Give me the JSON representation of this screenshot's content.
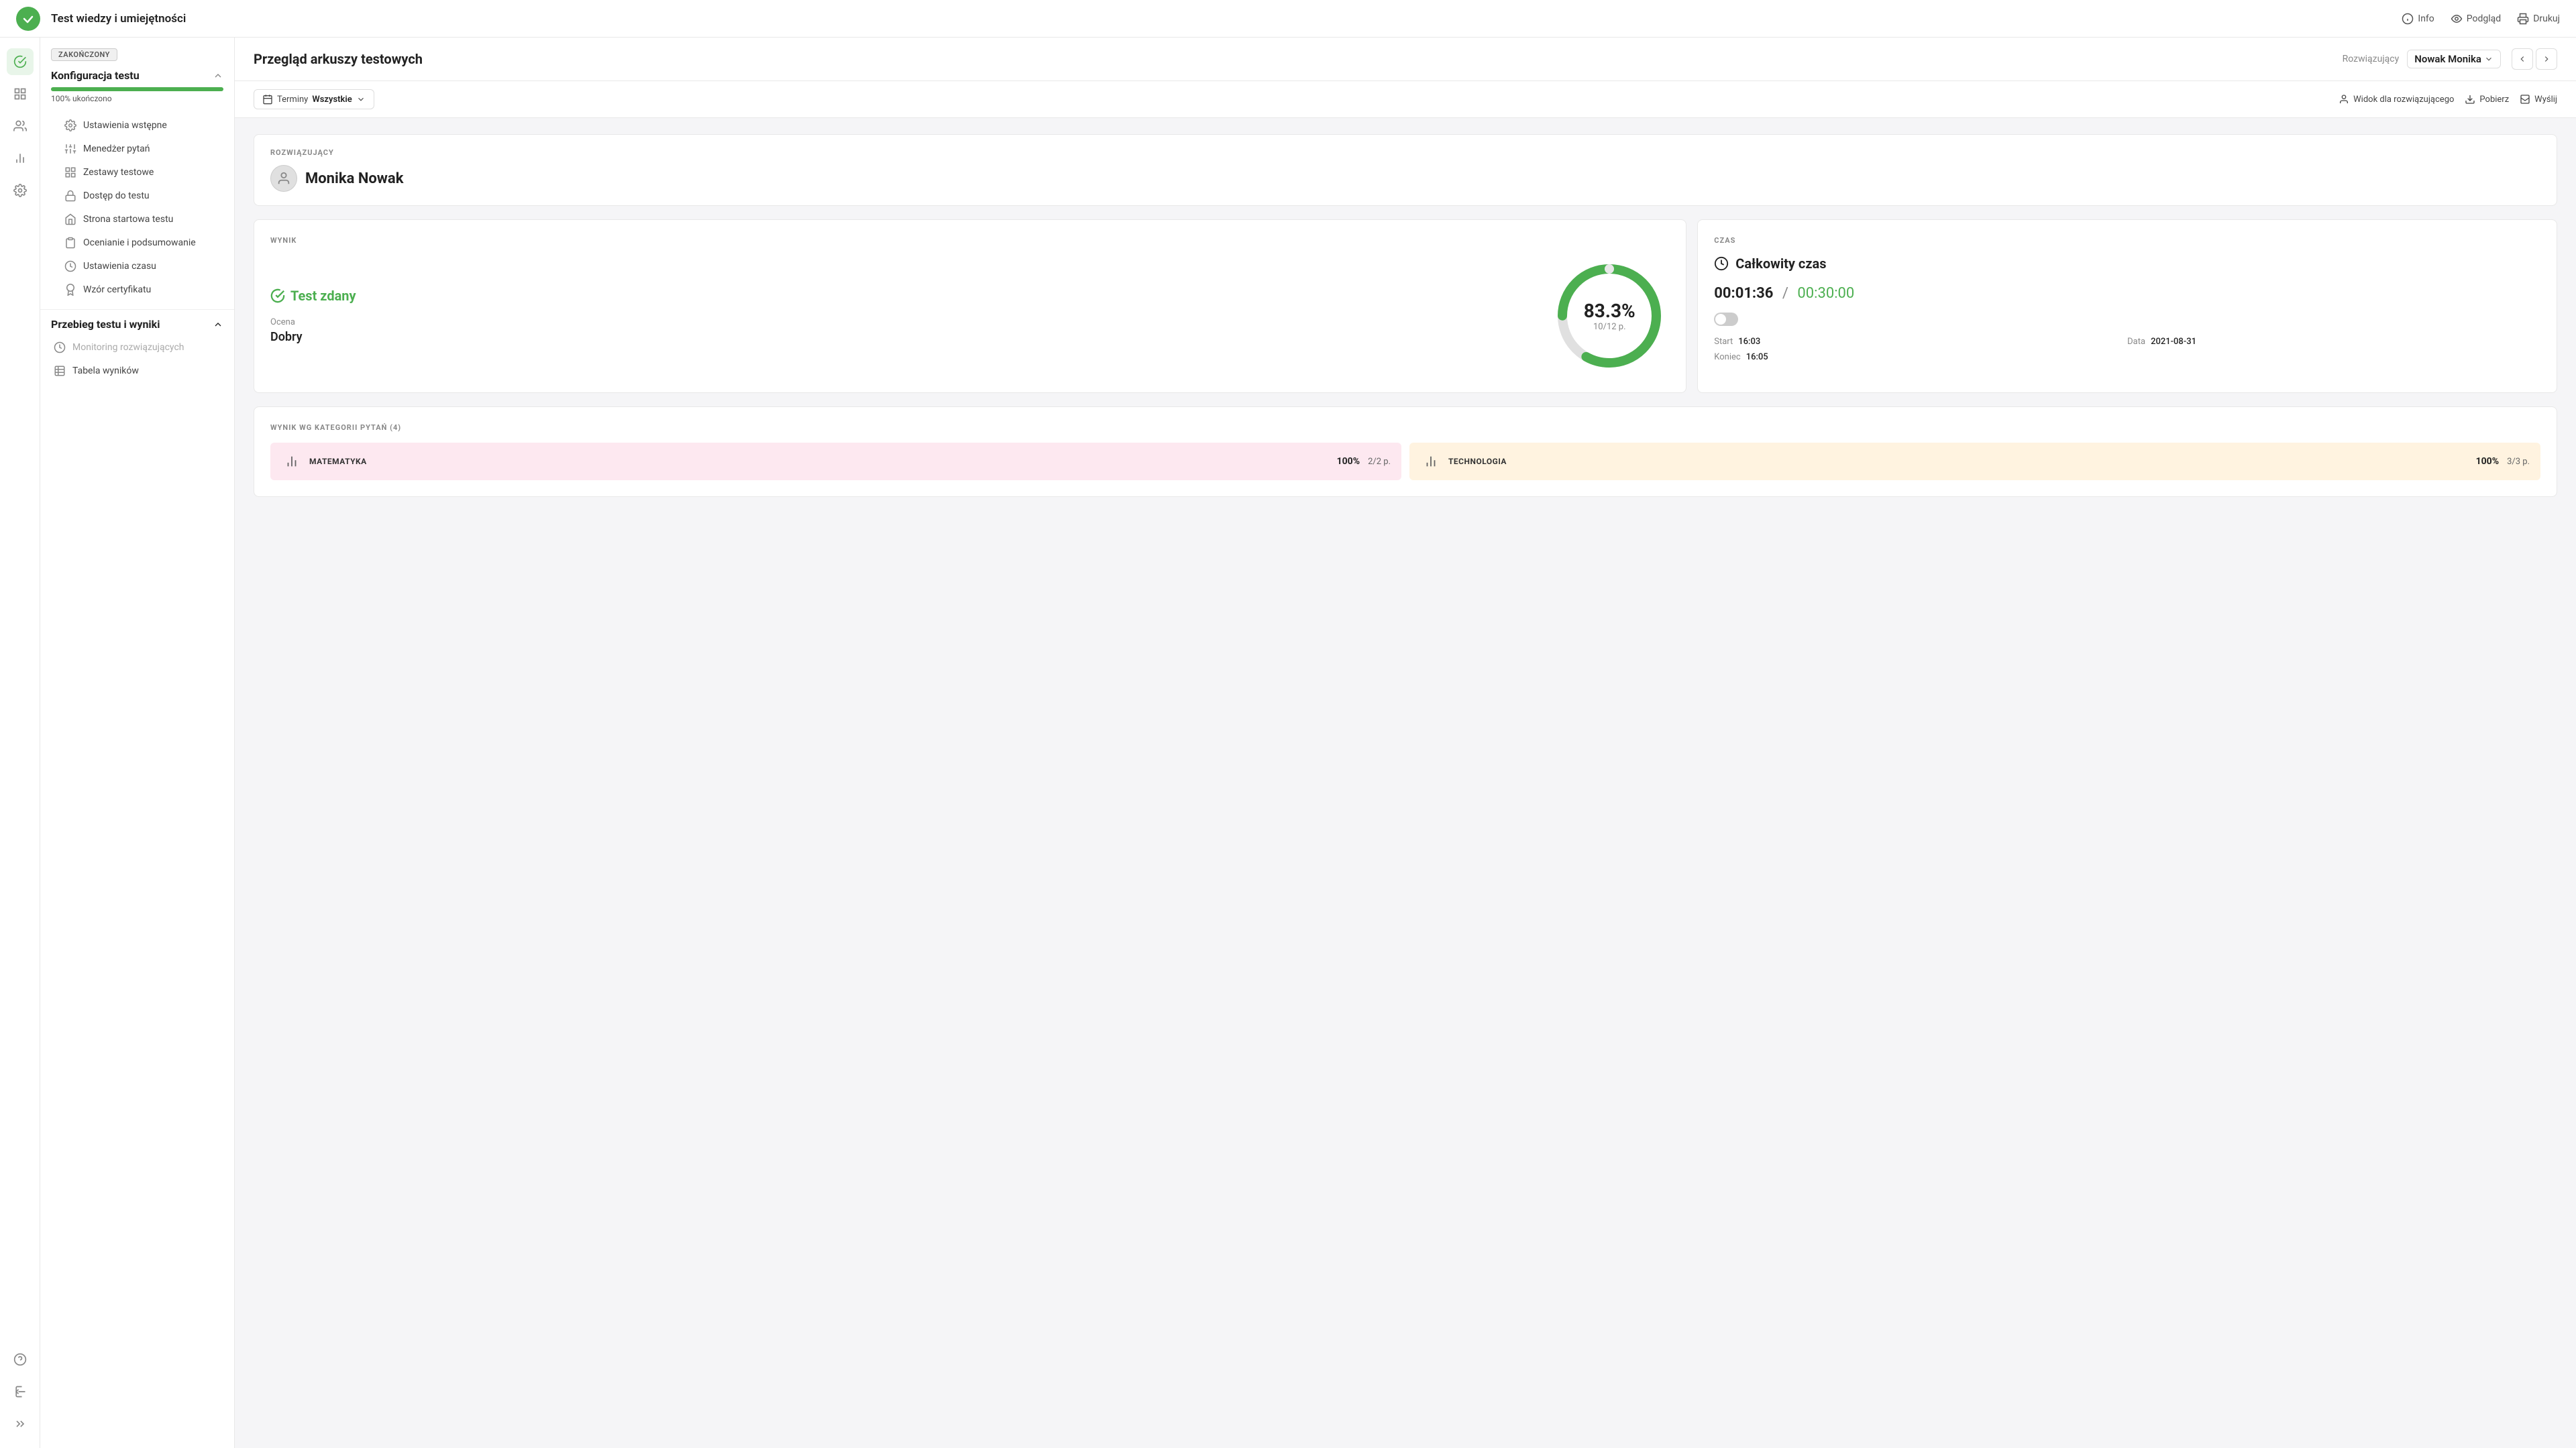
{
  "topbar": {
    "title": "Test wiedzy i umiejętności",
    "actions": {
      "info": "Info",
      "preview": "Podgląd",
      "print": "Drukuj"
    }
  },
  "sidebar_icons": {
    "items": [
      {
        "name": "check-icon",
        "symbol": "✓",
        "active": true
      },
      {
        "name": "grid-icon",
        "symbol": "⊞",
        "active": false
      },
      {
        "name": "users-icon",
        "symbol": "👤",
        "active": false
      },
      {
        "name": "chart-icon",
        "symbol": "📊",
        "active": false
      },
      {
        "name": "settings-icon",
        "symbol": "⚙",
        "active": false
      }
    ],
    "bottom": [
      {
        "name": "help-icon",
        "symbol": "?"
      },
      {
        "name": "exit-icon",
        "symbol": "⬅"
      },
      {
        "name": "expand-icon",
        "symbol": "»"
      }
    ]
  },
  "sidebar": {
    "badge": "ZAKOŃCZONY",
    "section1": {
      "title": "Konfiguracja testu",
      "progress_label": "100% ukończono",
      "progress_value": 100,
      "items": [
        {
          "label": "Ustawienia wstępne",
          "icon": "settings-icon"
        },
        {
          "label": "Menedżer pytań",
          "icon": "questions-icon"
        },
        {
          "label": "Zestawy testowe",
          "icon": "sets-icon"
        },
        {
          "label": "Dostęp do testu",
          "icon": "lock-icon"
        },
        {
          "label": "Strona startowa testu",
          "icon": "home-icon"
        },
        {
          "label": "Ocenianie i podsumowanie",
          "icon": "grade-icon"
        },
        {
          "label": "Ustawienia czasu",
          "icon": "clock-icon"
        },
        {
          "label": "Wzór certyfikatu",
          "icon": "cert-icon"
        }
      ]
    },
    "section2": {
      "title": "Przebieg testu i wyniki",
      "items": [
        {
          "label": "Monitoring rozwiązujących",
          "icon": "monitor-icon",
          "muted": true
        },
        {
          "label": "Tabela wyników",
          "icon": "table-icon",
          "muted": false
        }
      ]
    }
  },
  "content": {
    "header": {
      "title": "Przegląd arkuszy testowych",
      "resolver_label": "Rozwiązujący",
      "resolver_name": "Nowak Monika"
    },
    "toolbar": {
      "terms_label": "Terminy",
      "terms_value": "Wszystkie",
      "user_view": "Widok dla rozwiązującego",
      "download": "Pobierz",
      "send": "Wyślij"
    },
    "solver": {
      "section_label": "ROZWIĄZUJĄCY",
      "name": "Monika Nowak"
    },
    "result": {
      "section_label": "WYNIK",
      "status": "Test zdany",
      "grade_label": "Ocena",
      "grade": "Dobry",
      "percent": "83.3%",
      "points": "10/12 p."
    },
    "time": {
      "section_label": "CZAS",
      "title": "Całkowity czas",
      "used": "00:01:36",
      "separator": "/",
      "total": "00:30:00",
      "start_label": "Start",
      "start_value": "16:03",
      "date_label": "Data",
      "date_value": "2021-08-31",
      "end_label": "Koniec",
      "end_value": "16:05"
    },
    "categories": {
      "section_label": "WYNIK WG KATEGORII PYTAŃ (4)",
      "items": [
        {
          "name": "MATEMATYKA",
          "percent": "100%",
          "points": "2/2 p.",
          "color": "pink"
        },
        {
          "name": "TECHNOLOGIA",
          "percent": "100%",
          "points": "3/3 p.",
          "color": "orange"
        }
      ]
    }
  }
}
